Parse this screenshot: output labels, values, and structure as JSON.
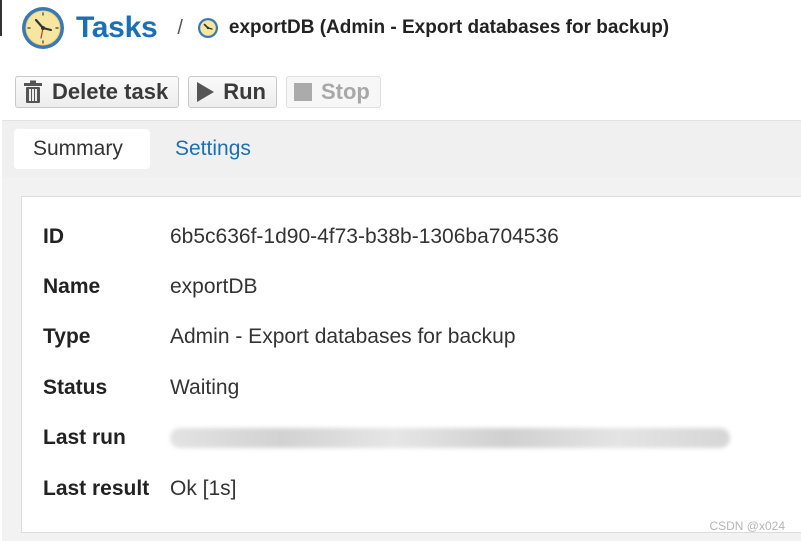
{
  "header": {
    "title": "Tasks",
    "separator": "/",
    "breadcrumb": "exportDB (Admin - Export databases for backup)"
  },
  "toolbar": {
    "delete_label": "Delete task",
    "run_label": "Run",
    "stop_label": "Stop"
  },
  "tabs": [
    {
      "label": "Summary",
      "active": true
    },
    {
      "label": "Settings",
      "active": false
    }
  ],
  "summary": {
    "rows": [
      {
        "label": "ID",
        "value": "6b5c636f-1d90-4f73-b38b-1306ba704536"
      },
      {
        "label": "Name",
        "value": "exportDB"
      },
      {
        "label": "Type",
        "value": "Admin - Export databases for backup"
      },
      {
        "label": "Status",
        "value": "Waiting"
      },
      {
        "label": "Last run",
        "value": ""
      },
      {
        "label": "Last result",
        "value": "Ok [1s]"
      }
    ]
  },
  "watermark": "CSDN @x024",
  "colors": {
    "accent": "#1b6fb5",
    "tab_strip": "#f0f0f0",
    "clock_face": "#f6e6a0",
    "clock_ring": "#3a78b5"
  },
  "icons": {
    "app": "clock-icon",
    "breadcrumb": "clock-icon",
    "delete": "trash-icon",
    "run": "play-icon",
    "stop": "stop-icon"
  }
}
